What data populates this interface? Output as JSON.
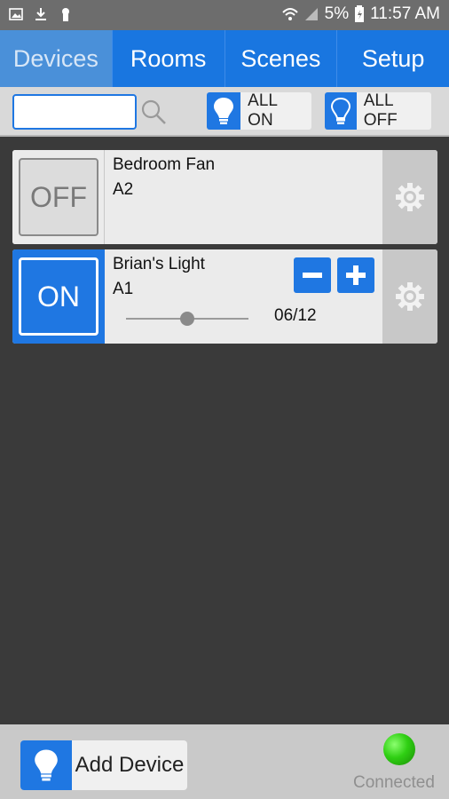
{
  "status_bar": {
    "left_icons": [
      "image-icon",
      "download-icon",
      "keyhole-icon"
    ],
    "battery_percent": "5%",
    "time": "11:57 AM"
  },
  "tabs": [
    {
      "label": "Devices",
      "active": true
    },
    {
      "label": "Rooms",
      "active": false
    },
    {
      "label": "Scenes",
      "active": false
    },
    {
      "label": "Setup",
      "active": false
    }
  ],
  "toolbar": {
    "search_value": "",
    "search_placeholder": "",
    "all_on_label": "ALL ON",
    "all_off_label": "ALL OFF"
  },
  "devices": [
    {
      "name": "Bedroom Fan",
      "address": "A2",
      "state_label": "OFF"
    },
    {
      "name": "Brian's Light",
      "address": "A1",
      "state_label": "ON",
      "level_text": "06/12",
      "level_fraction": 0.5
    }
  ],
  "footer": {
    "add_label": "Add Device",
    "connection_label": "Connected"
  },
  "colors": {
    "accent": "#1f77e2",
    "background": "#3a3a3a",
    "connected": "#2fcf13"
  }
}
